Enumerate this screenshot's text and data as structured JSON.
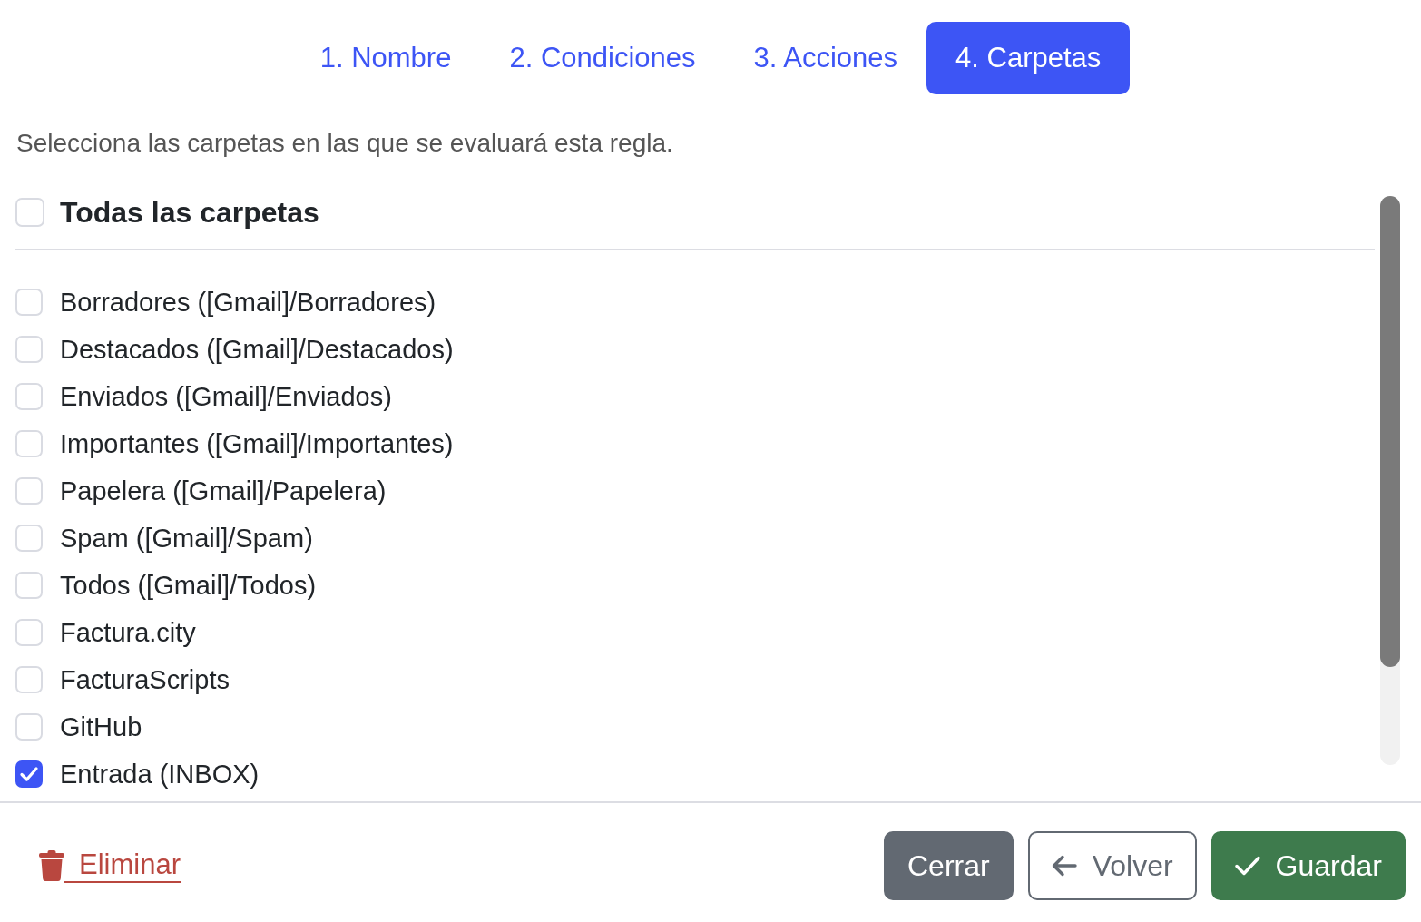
{
  "tabs": [
    {
      "label": "1. Nombre",
      "selected": false
    },
    {
      "label": "2. Condiciones",
      "selected": false
    },
    {
      "label": "3. Acciones",
      "selected": false
    },
    {
      "label": "4. Carpetas",
      "selected": true
    }
  ],
  "description": "Selecciona las carpetas en las que se evaluará esta regla.",
  "all_folders": {
    "label": "Todas las carpetas",
    "checked": false
  },
  "folders": [
    {
      "label": "Borradores ([Gmail]/Borradores)",
      "checked": false
    },
    {
      "label": "Destacados ([Gmail]/Destacados)",
      "checked": false
    },
    {
      "label": "Enviados ([Gmail]/Enviados)",
      "checked": false
    },
    {
      "label": "Importantes ([Gmail]/Importantes)",
      "checked": false
    },
    {
      "label": "Papelera ([Gmail]/Papelera)",
      "checked": false
    },
    {
      "label": "Spam ([Gmail]/Spam)",
      "checked": false
    },
    {
      "label": "Todos ([Gmail]/Todos)",
      "checked": false
    },
    {
      "label": "Factura.city",
      "checked": false
    },
    {
      "label": "FacturaScripts",
      "checked": false
    },
    {
      "label": "GitHub",
      "checked": false
    },
    {
      "label": "Entrada (INBOX)",
      "checked": true
    }
  ],
  "footer": {
    "delete_link": "Eliminar",
    "buttons": [
      {
        "label": "Cerrar",
        "kind": "close"
      },
      {
        "label": "Volver",
        "kind": "back"
      },
      {
        "label": "Guardar",
        "kind": "save"
      }
    ]
  }
}
